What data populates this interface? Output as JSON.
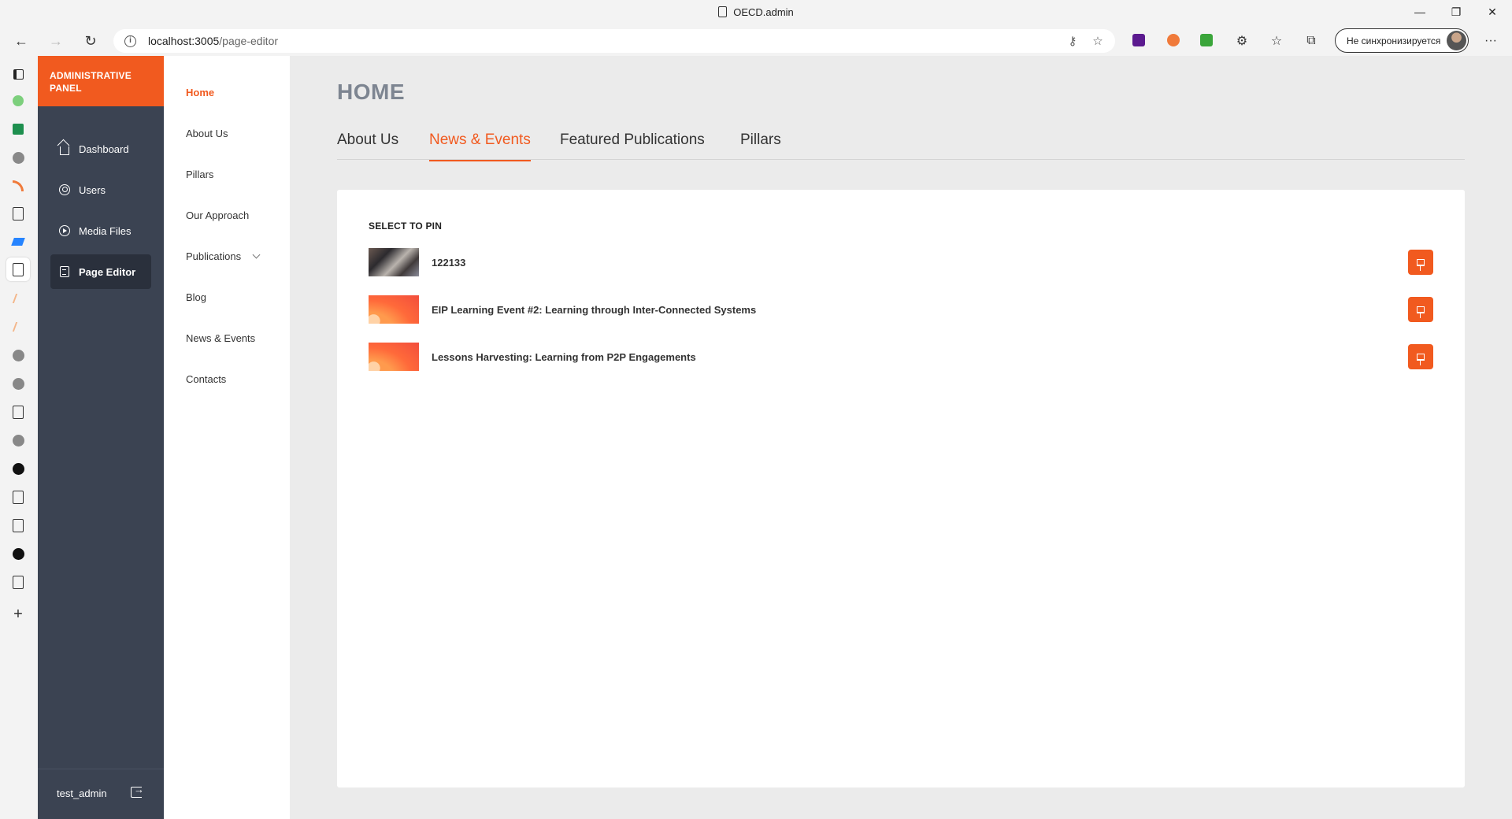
{
  "browser": {
    "window_title": "OECD.admin",
    "url_host": "localhost:3005",
    "url_path": "/page-editor",
    "sync_label": "Не синхронизируется"
  },
  "admin_panel": {
    "brand": "ADMINISTRATIVE PANEL",
    "nav": [
      {
        "label": "Dashboard",
        "icon": "home-icon"
      },
      {
        "label": "Users",
        "icon": "user-circle-icon"
      },
      {
        "label": "Media Files",
        "icon": "play-circle-icon"
      },
      {
        "label": "Page Editor",
        "icon": "document-icon",
        "active": true
      }
    ],
    "username": "test_admin"
  },
  "pages": {
    "items": [
      {
        "label": "Home",
        "active": true
      },
      {
        "label": "About Us"
      },
      {
        "label": "Pillars"
      },
      {
        "label": "Our Approach"
      },
      {
        "label": "Publications",
        "has_submenu": true
      },
      {
        "label": "Blog"
      },
      {
        "label": "News & Events"
      },
      {
        "label": "Contacts"
      }
    ]
  },
  "main": {
    "title": "HOME",
    "tabs": [
      {
        "label": "About Us"
      },
      {
        "label": "News & Events",
        "active": true
      },
      {
        "label": "Featured Publications"
      },
      {
        "label": "Pillars"
      }
    ],
    "card": {
      "heading": "SELECT TO PIN",
      "items": [
        {
          "title": "122133",
          "thumb": "photo"
        },
        {
          "title": "EIP Learning Event #2: Learning through Inter-Connected Systems",
          "thumb": "orange-gradient"
        },
        {
          "title": "Lessons Harvesting: Learning from P2P Engagements",
          "thumb": "orange-gradient"
        }
      ]
    }
  },
  "colors": {
    "accent": "#f15a1f",
    "sidebar_bg": "#3b4352",
    "title_gray": "#7d8591",
    "main_bg": "#ebebeb"
  }
}
